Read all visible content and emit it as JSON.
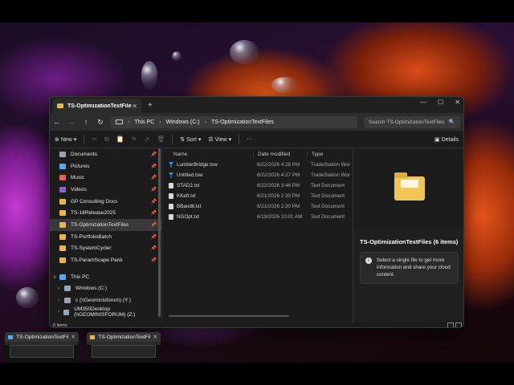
{
  "window": {
    "tab_title": "TS-OptimizationTextFiles",
    "tab_close": "✕",
    "new_tab": "+",
    "controls": {
      "minimize": "—",
      "maximize": "☐",
      "close": "✕"
    }
  },
  "address": {
    "back": "←",
    "forward": "→",
    "up": "↑",
    "refresh": "↻",
    "crumbs": [
      "This PC",
      "Windows (C:)",
      "TS-OptimizationTextFiles"
    ],
    "separator": "›",
    "search_placeholder": "Search TS-OptimizationTextFiles",
    "search_icon": "🔍"
  },
  "toolbar": {
    "new_label": "New",
    "sort_label": "Sort",
    "view_label": "View",
    "more_label": "···",
    "details_label": "Details",
    "cut_icon": "✂",
    "copy_icon": "⧉",
    "paste_icon": "📋",
    "rename_icon": "✎",
    "share_icon": "↗",
    "delete_icon": "🗑"
  },
  "sidebar": {
    "items": [
      {
        "label": "Documents",
        "color": "#9aa4b0",
        "pinned": true
      },
      {
        "label": "Pictures",
        "color": "#5aa9e6",
        "pinned": true
      },
      {
        "label": "Music",
        "color": "#e0635a",
        "pinned": true
      },
      {
        "label": "Videos",
        "color": "#8a63d2",
        "pinned": true
      },
      {
        "label": "GP Consulting Docs",
        "color": "#e8b64a",
        "pinned": true
      },
      {
        "label": "TS-18Release2025",
        "color": "#e8b64a",
        "pinned": true
      },
      {
        "label": "TS-OptimizationTextFiles",
        "color": "#e8b64a",
        "pinned": true,
        "selected": true
      },
      {
        "label": "TS-PortfolioBatch",
        "color": "#e8b64a",
        "pinned": true
      },
      {
        "label": "TS-SystemCycler",
        "color": "#e8b64a",
        "pinned": true
      },
      {
        "label": "TS-ParamScape Pank",
        "color": "#e8b64a",
        "pinned": true
      }
    ],
    "tree": [
      {
        "label": "This PC",
        "caret": "∨",
        "indent": 0
      },
      {
        "label": "Windows (C:)",
        "caret": "›",
        "indent": 1
      },
      {
        "label": "c (\\\\Geominisforum) (Y:)",
        "caret": "›",
        "indent": 1
      },
      {
        "label": "UM350Desktop (\\\\GEOMINISFORUM) (Z:)",
        "caret": "›",
        "indent": 1
      }
    ],
    "pin_glyph": "📌"
  },
  "filelist": {
    "headers": {
      "name": "Name",
      "date": "Date modified",
      "type": "Type"
    },
    "files": [
      {
        "name": "LumberBridge.tsw",
        "date": "6/22/2026 4:28 PM",
        "type": "TradeStation Wor",
        "icon": "tsw"
      },
      {
        "name": "Untitled.tsw",
        "date": "6/22/2026 4:27 PM",
        "type": "TradeStation Wor",
        "icon": "tsw"
      },
      {
        "name": "STAD2.txt",
        "date": "6/22/2026 3:46 PM",
        "type": "Text Document",
        "icon": "txt"
      },
      {
        "name": "KKeft.txt",
        "date": "6/21/2026 2:30 PM",
        "type": "Text Document",
        "icon": "txt"
      },
      {
        "name": "BBandit.txt",
        "date": "6/21/2026 2:30 PM",
        "type": "Text Document",
        "icon": "txt"
      },
      {
        "name": "NGOpt.txt",
        "date": "6/19/2026 10:01 AM",
        "type": "Text Document",
        "icon": "txt"
      }
    ]
  },
  "details": {
    "title": "TS-OptimizationTextFiles (6 items)",
    "info_text": "Select a single file to get more information and share your cloud content."
  },
  "status": {
    "count": "6 items"
  },
  "taskbar": {
    "thumbs": [
      {
        "title": "TS-OptimizationTextFiles",
        "icon": "pc"
      },
      {
        "title": "TS-OptimizationTextFiles",
        "icon": "folder"
      }
    ]
  }
}
